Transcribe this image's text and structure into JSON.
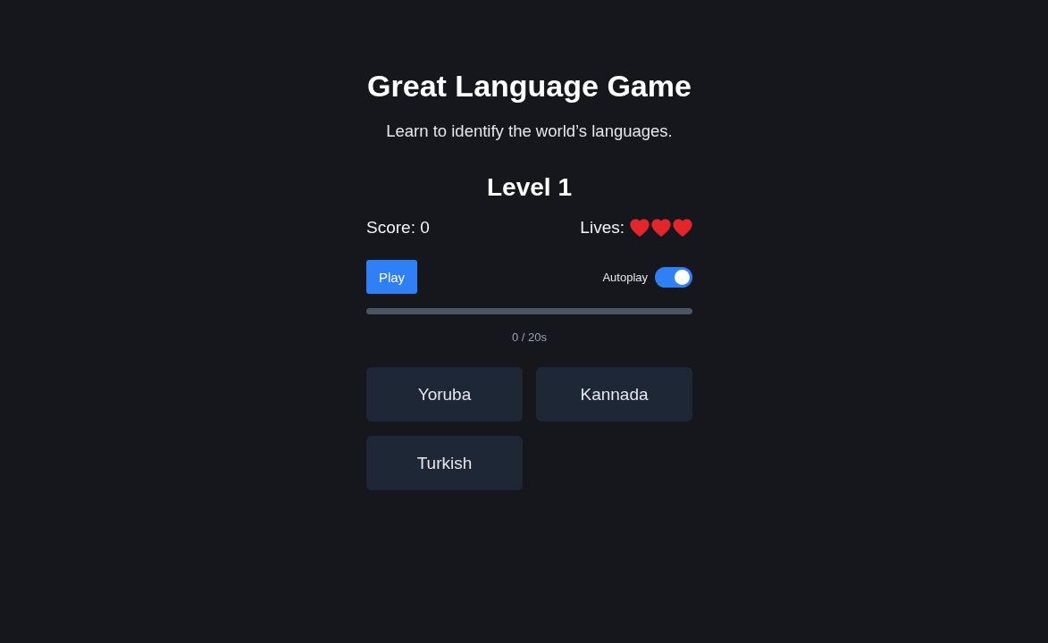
{
  "header": {
    "title": "Great Language Game",
    "subtitle": "Learn to identify the world’s languages."
  },
  "level_title": "Level 1",
  "score": "Score: 0",
  "lives": {
    "label": "Lives:",
    "hearts": [
      {
        "full": true
      },
      {
        "full": true
      },
      {
        "full": true
      }
    ]
  },
  "controls": {
    "play_button": "Play",
    "autoplay": {
      "label": "Autoplay",
      "on": true
    }
  },
  "progress": {
    "level": 0,
    "reading": "0 / 20s"
  },
  "options": [
    {
      "label": "Yoruba",
      "selected": false
    },
    {
      "label": "Kannada",
      "selected": false
    },
    {
      "label": "Turkish",
      "selected": false
    }
  ]
}
